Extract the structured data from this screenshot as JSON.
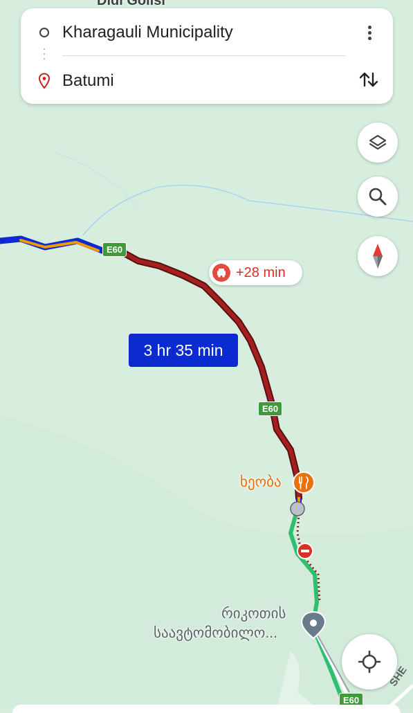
{
  "search": {
    "origin": "Kharagauli Municipality",
    "destination": "Batumi",
    "more_icon": "more-vert-icon",
    "swap_icon": "swap-vert-icon"
  },
  "controls": {
    "layers_icon": "layers-icon",
    "search_icon": "search-icon",
    "compass_icon": "compass-icon",
    "location_icon": "my-location-icon"
  },
  "route": {
    "duration": "3 hr 35 min",
    "traffic_delay": "+28 min"
  },
  "map_labels": {
    "road_shield": "E60",
    "poi_restaurant": "ხეობა",
    "poi_station_line1": "რიკოთის",
    "poi_station_line2": "საავტომობილო...",
    "top_place_partial": "Didi Golisi",
    "bottom_road_partial": "SHE"
  },
  "colors": {
    "map_bg": "#d7eedf",
    "route_traffic": "#8b1a1a",
    "route_primary": "#0b2bd1",
    "route_moderate": "#f29900",
    "route_clear": "#2fbf71",
    "poi_restaurant": "#e8710a",
    "road_shield": "#3f9a3a"
  }
}
